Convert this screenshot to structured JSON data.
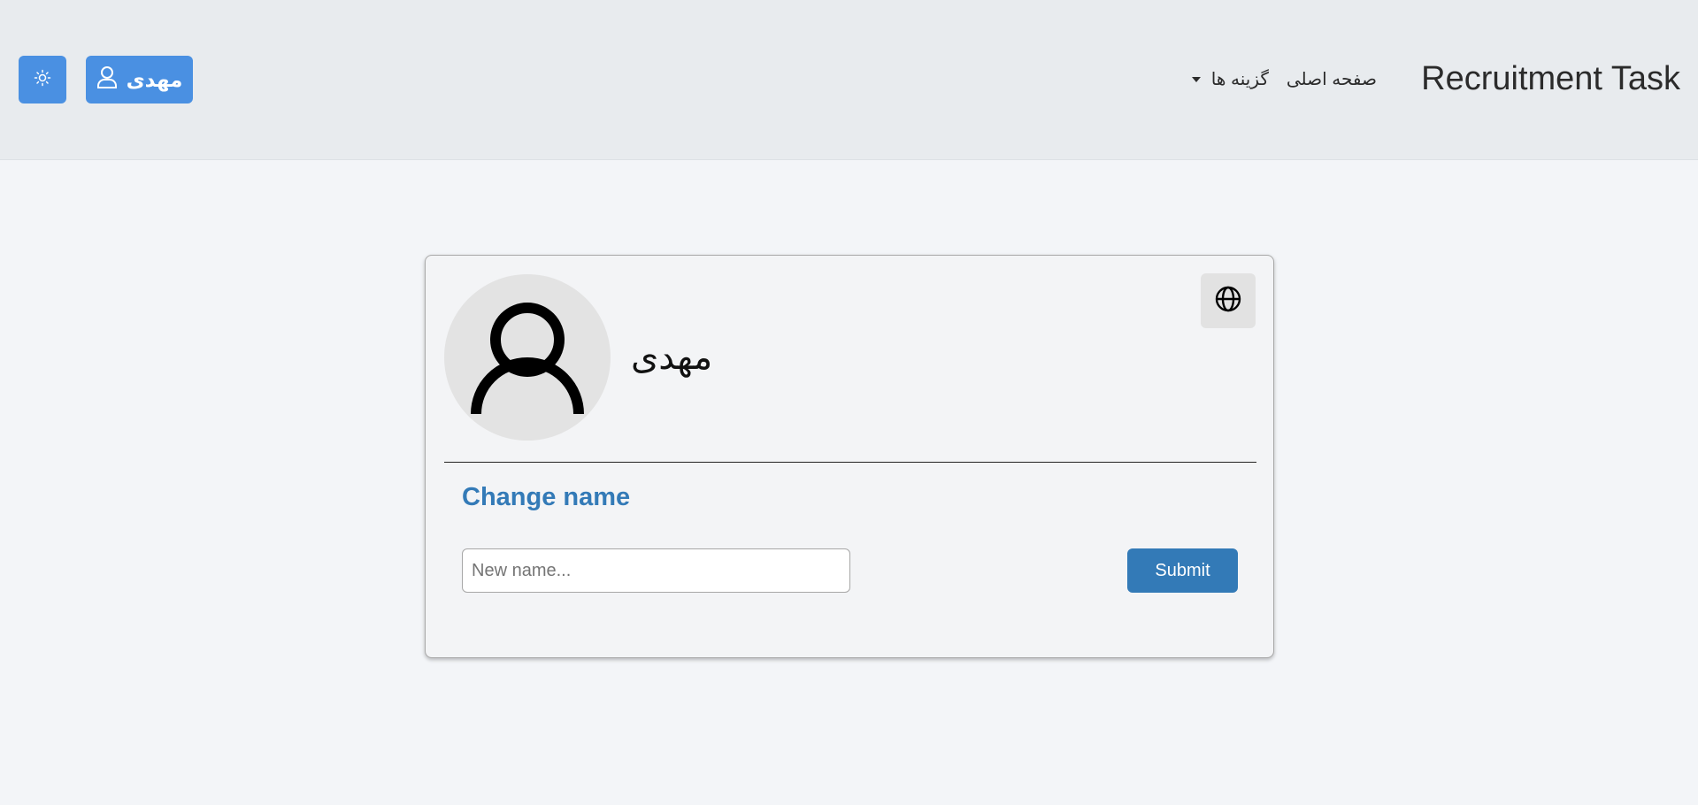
{
  "header": {
    "brand": "Recruitment Task",
    "nav": {
      "home_label": "صفحه اصلی",
      "options_label": "گزینه ها"
    },
    "user_button_label": "مهدی",
    "theme_icon": "sun-icon",
    "user_icon": "user-icon"
  },
  "profile": {
    "name": "مهدی",
    "avatar_icon": "user-avatar-icon",
    "language_icon": "globe-icon"
  },
  "change_name": {
    "title": "Change name",
    "input_value": "",
    "input_placeholder": "New name...",
    "submit_label": "Submit"
  },
  "colors": {
    "primary": "#4a90e2",
    "accent": "#337ab7",
    "header_bg": "#e8ebee",
    "page_bg": "#f3f5f8"
  }
}
